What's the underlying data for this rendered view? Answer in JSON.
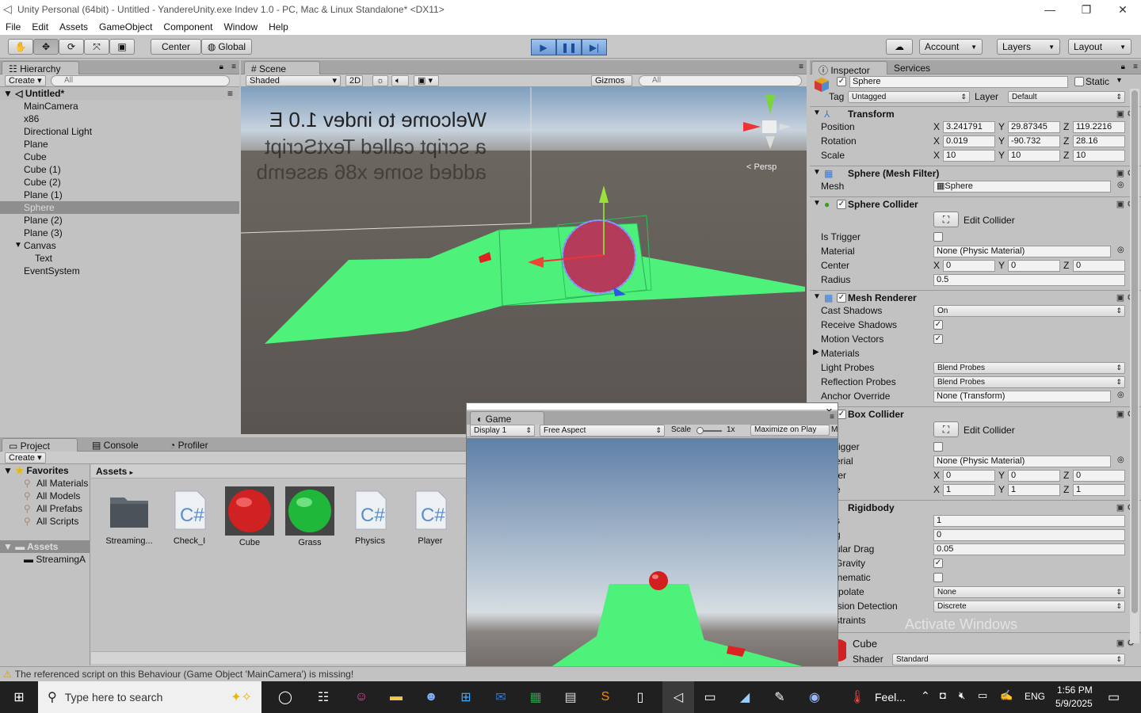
{
  "window": {
    "title": "Unity Personal (64bit) - Untitled - YandereUnity.exe Indev 1.0 - PC, Mac & Linux Standalone* <DX11>"
  },
  "menu": [
    "File",
    "Edit",
    "Assets",
    "GameObject",
    "Component",
    "Window",
    "Help"
  ],
  "toolbar": {
    "center": "Center",
    "global": "Global",
    "account": "Account",
    "layers": "Layers",
    "layout": "Layout"
  },
  "hierarchy": {
    "tab": "Hierarchy",
    "create": "Create",
    "search_placeholder": "All",
    "scene": "Untitled*",
    "items": [
      "MainCamera",
      "x86",
      "Directional Light",
      "Plane",
      "Cube",
      "Cube (1)",
      "Cube (2)",
      "Plane (1)",
      "Sphere",
      "Plane (2)",
      "Plane (3)",
      "Canvas",
      "Text",
      "EventSystem"
    ]
  },
  "scene": {
    "tab": "Scene",
    "shading": "Shaded",
    "mode2d": "2D",
    "gizmos": "Gizmos",
    "search_placeholder": "All",
    "persp": "Persp",
    "text_lines": [
      "Welcome to indev 1.0 E",
      "a script called TextScript",
      "added some x86 assemb"
    ]
  },
  "project": {
    "tabs": [
      "Project",
      "Console",
      "Profiler"
    ],
    "create": "Create",
    "favorites_label": "Favorites",
    "favorites": [
      "All Materials",
      "All Models",
      "All Prefabs",
      "All Scripts"
    ],
    "assets_label": "Assets",
    "assets_children": [
      "StreamingA"
    ],
    "breadcrumb": "Assets",
    "assets": [
      {
        "name": "Streaming...",
        "kind": "folder"
      },
      {
        "name": "Check_I",
        "kind": "script"
      },
      {
        "name": "Cube",
        "kind": "red"
      },
      {
        "name": "Grass",
        "kind": "green"
      },
      {
        "name": "Physics",
        "kind": "script"
      },
      {
        "name": "Player",
        "kind": "script"
      }
    ]
  },
  "game": {
    "tab": "Game",
    "display": "Display 1",
    "aspect": "Free Aspect",
    "scale_label": "Scale",
    "scale_value": "1x",
    "maximize": "Maximize on Play",
    "m": "M"
  },
  "inspector": {
    "tabs": [
      "Inspector",
      "Services"
    ],
    "name": "Sphere",
    "static": "Static",
    "tag_label": "Tag",
    "tag": "Untagged",
    "layer_label": "Layer",
    "layer": "Default",
    "transform": {
      "title": "Transform",
      "position_label": "Position",
      "position": [
        "3.241791",
        "29.87345",
        "119.2216"
      ],
      "rotation_label": "Rotation",
      "rotation": [
        "0.019",
        "-90.732",
        "28.16"
      ],
      "scale_label": "Scale",
      "scale": [
        "10",
        "10",
        "10"
      ]
    },
    "mesh_filter": {
      "title": "Sphere (Mesh Filter)",
      "mesh_label": "Mesh",
      "mesh": "Sphere"
    },
    "sphere_collider": {
      "title": "Sphere Collider",
      "edit": "Edit Collider",
      "is_trigger": "Is Trigger",
      "material_label": "Material",
      "material": "None (Physic Material)",
      "center_label": "Center",
      "center": [
        "0",
        "0",
        "0"
      ],
      "radius_label": "Radius",
      "radius": "0.5"
    },
    "mesh_renderer": {
      "title": "Mesh Renderer",
      "cast_shadows_label": "Cast Shadows",
      "cast_shadows": "On",
      "receive_shadows": "Receive Shadows",
      "motion_vectors": "Motion Vectors",
      "materials": "Materials",
      "light_probes_label": "Light Probes",
      "light_probes": "Blend Probes",
      "reflection_probes_label": "Reflection Probes",
      "reflection_probes": "Blend Probes",
      "anchor_label": "Anchor Override",
      "anchor": "None (Transform)"
    },
    "box_collider": {
      "title": "Box Collider",
      "edit": "Edit Collider",
      "trigger": "rigger",
      "material_label": "erial",
      "material": "None (Physic Material)",
      "center_label": "ter",
      "center": [
        "0",
        "0",
        "0"
      ],
      "size_label": "e",
      "size": [
        "1",
        "1",
        "1"
      ]
    },
    "rigidbody": {
      "title": "Rigidbody",
      "mass_label": "s",
      "mass": "1",
      "drag_label": "g",
      "drag": "0",
      "angular_label": "ular Drag",
      "angular": "0.05",
      "gravity_label": "Gravity",
      "kinematic_label": "inematic",
      "interp_label": "rpolate",
      "interp": "None",
      "collision_label": "ision Detection",
      "collision": "Discrete",
      "constraints_label": "straints"
    },
    "material": {
      "name": "Cube",
      "shader_label": "Shader",
      "shader": "Standard"
    },
    "watermark": "Activate Windows"
  },
  "status": {
    "message": "The referenced script on this Behaviour (Game Object 'MainCamera') is missing!"
  },
  "taskbar": {
    "search_placeholder": "Type here to search",
    "feel": "Feel...",
    "lang": "ENG",
    "time": "1:56 PM",
    "date": "5/9/2025"
  }
}
